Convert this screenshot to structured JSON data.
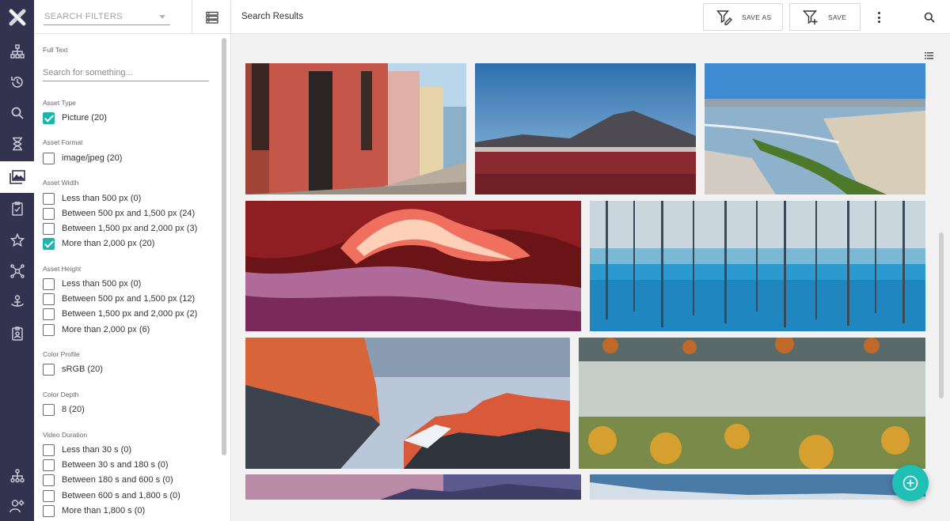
{
  "colors": {
    "rail_bg": "#33334f",
    "accent": "#1fb5ad",
    "fab": "#1fbfb6",
    "results_bg": "#f2f2f2"
  },
  "rail": {
    "logo_icon": "x-logo-icon",
    "items": [
      {
        "icon": "hierarchy-icon"
      },
      {
        "icon": "history-icon"
      },
      {
        "icon": "search-icon"
      },
      {
        "icon": "hourglass-icon"
      },
      {
        "icon": "images-icon",
        "active": true
      },
      {
        "icon": "clipboard-check-icon"
      },
      {
        "icon": "star-icon"
      },
      {
        "icon": "network-icon"
      },
      {
        "icon": "anchor-person-icon"
      },
      {
        "icon": "badge-icon"
      }
    ],
    "bottom_items": [
      {
        "icon": "org-chart-icon"
      },
      {
        "icon": "user-settings-icon"
      }
    ]
  },
  "filters": {
    "select_placeholder": "SEARCH FILTERS",
    "full_text": {
      "label": "Full Text",
      "placeholder": "Search for something..."
    },
    "groups": [
      {
        "label": "Asset Type",
        "options": [
          {
            "label": "Picture (20)",
            "checked": true
          }
        ]
      },
      {
        "label": "Asset Format",
        "options": [
          {
            "label": "image/jpeg (20)",
            "checked": false
          }
        ]
      },
      {
        "label": "Asset Width",
        "options": [
          {
            "label": "Less than 500 px (0)",
            "checked": false
          },
          {
            "label": "Between 500 px and 1,500 px (24)",
            "checked": false
          },
          {
            "label": "Between 1,500 px and 2,000 px (3)",
            "checked": false
          },
          {
            "label": "More than 2,000 px (20)",
            "checked": true
          }
        ]
      },
      {
        "label": "Asset Height",
        "options": [
          {
            "label": "Less than 500 px (0)",
            "checked": false
          },
          {
            "label": "Between 500 px and 1,500 px (12)",
            "checked": false
          },
          {
            "label": "Between 1,500 px and 2,000 px (2)",
            "checked": false
          },
          {
            "label": "More than 2,000 px (6)",
            "checked": false
          }
        ]
      },
      {
        "label": "Color Profile",
        "options": [
          {
            "label": "sRGB (20)",
            "checked": false
          }
        ]
      },
      {
        "label": "Color Depth",
        "options": [
          {
            "label": "8 (20)",
            "checked": false
          }
        ]
      },
      {
        "label": "Video Duration",
        "options": [
          {
            "label": "Less than 30 s (0)",
            "checked": false
          },
          {
            "label": "Between 30 s and 180 s (0)",
            "checked": false
          },
          {
            "label": "Between 180 s and 600 s (0)",
            "checked": false
          },
          {
            "label": "Between 600 s and 1,800 s (0)",
            "checked": false
          },
          {
            "label": "More than 1,800 s (0)",
            "checked": false
          }
        ]
      }
    ]
  },
  "topbar": {
    "title": "Search Results",
    "save_as_label": "SAVE AS",
    "save_label": "SAVE"
  },
  "results": {
    "images": [
      {
        "name": "colorful-street-houses"
      },
      {
        "name": "red-lagoon-volcano"
      },
      {
        "name": "salt-flat-wetland"
      },
      {
        "name": "slot-canyon-waves"
      },
      {
        "name": "blue-pond-dead-trees"
      },
      {
        "name": "granite-cliff-sunset"
      },
      {
        "name": "misty-autumn-forest"
      },
      {
        "name": "purple-sky-mountains"
      },
      {
        "name": "blue-misty-hills"
      }
    ]
  }
}
